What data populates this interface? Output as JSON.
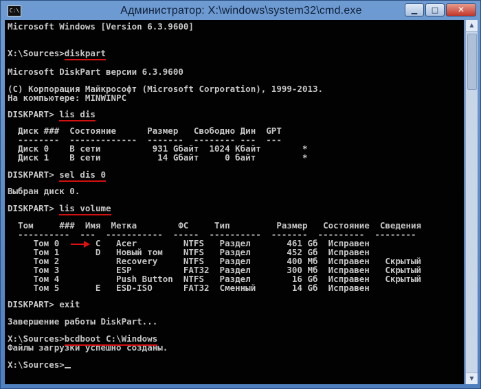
{
  "window": {
    "title": "Администратор: X:\\windows\\system32\\cmd.exe",
    "icon_text": "C:\\",
    "controls": {
      "minimize": "▁",
      "maximize": "□",
      "close": "✕"
    }
  },
  "console": {
    "header": "Microsoft Windows [Version 6.3.9600]",
    "prompt1": "X:\\Sources>",
    "cmd_diskpart": "diskpart",
    "diskpart_version": "Microsoft DiskPart версии 6.3.9600",
    "copyright": "(C) Корпорация Майкрософт (Microsoft Corporation), 1999-2013.",
    "computer": "На компьютере: MINWINPC",
    "dp_prompt": "DISKPART> ",
    "cmd_lis_dis": "lis dis",
    "disk_table": {
      "header": "  Диск ###  Состояние      Размер   Свободно Дин  GPT",
      "divider": "  --------  -------------  -------  -------- ---  ---",
      "rows": [
        "  Диск 0    В сети          931 Gбайт  1024 Kбайт        *",
        "  Диск 1    В сети           14 Gбайт     0 байт         *"
      ]
    },
    "cmd_sel_dis": "sel dis 0",
    "disk_selected": "Выбран диск 0.",
    "cmd_lis_volume": "lis volume",
    "volume_table": {
      "header": "  Том     ###  Имя  Метка        ФС     Тип         Размер   Состояние  Сведения",
      "divider": "  ----------  ---  -----------  -----  ----------  -------  ---------  --------",
      "rows": [
        "     Том 0       C   Acer         NTFS   Раздел       461 Gб  Исправен",
        "     Том 1       D   Новый том    NTFS   Раздел       452 Gб  Исправен",
        "     Том 2           Recovery     NTFS   Раздел       400 Mб  Исправен   Скрытый",
        "     Том 3           ESP          FAT32  Раздел       300 Mб  Исправен   Скрытый",
        "     Том 4           Push Button  NTFS   Раздел        16 Gб  Исправен   Скрытый",
        "     Том 5       E   ESD-ISO      FAT32  Сменный       14 Gб  Исправен"
      ]
    },
    "exit_line": "DISKPART> exit",
    "diskpart_exit": "Завершение работы DiskPart...",
    "prompt2": "X:\\Sources>",
    "cmd_bcdboot": "bcdboot C:\\Windows",
    "bcdboot_result": "Файлы загрузки успешно созданы.",
    "prompt3": "X:\\Sources>"
  },
  "colors": {
    "console_bg": "#020202",
    "console_text": "#c6c6c6",
    "annotation_red": "#d51010"
  }
}
